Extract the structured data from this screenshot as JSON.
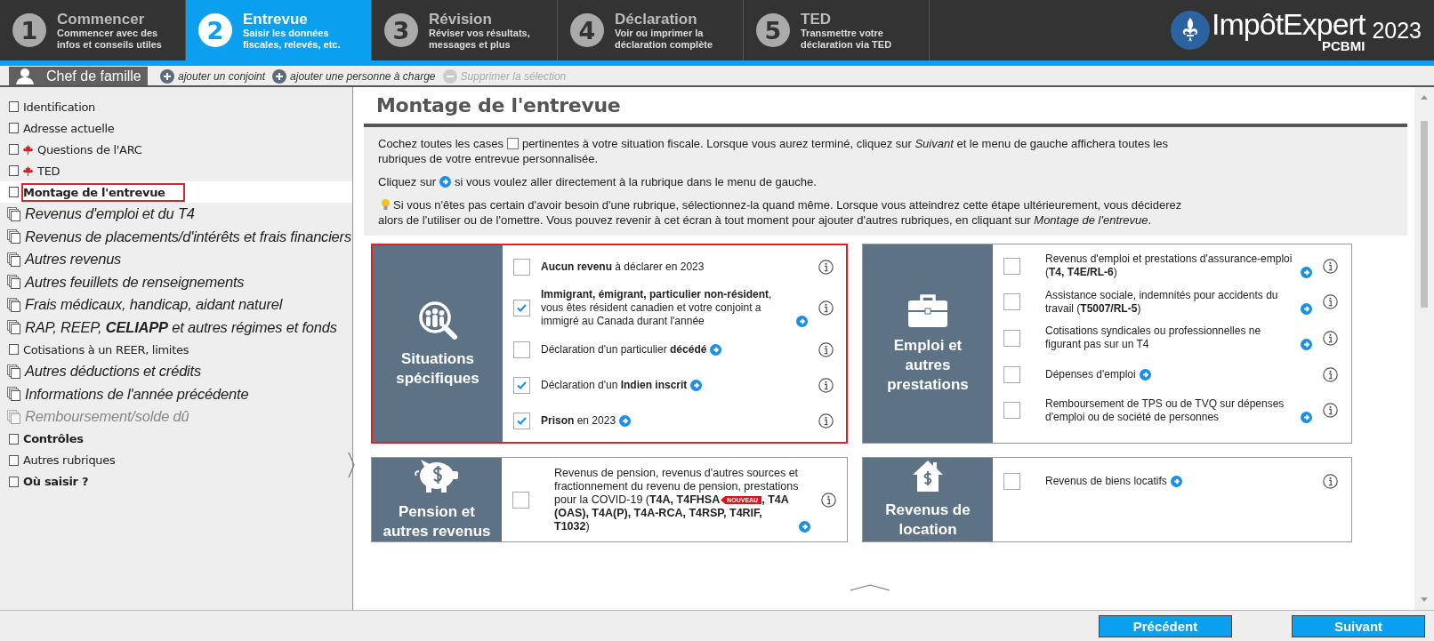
{
  "steps": [
    {
      "number": "1",
      "title": "Commencer",
      "subtitle": "Commencer avec des infos et conseils utiles",
      "selected": false
    },
    {
      "number": "2",
      "title": "Entrevue",
      "subtitle": "Saisir les données fiscales, relevés, etc.",
      "selected": true
    },
    {
      "number": "3",
      "title": "Révision",
      "subtitle": "Réviser vos résultats, messages et plus",
      "selected": false
    },
    {
      "number": "4",
      "title": "Déclaration",
      "subtitle": "Voir ou imprimer la déclaration complète",
      "selected": false
    },
    {
      "number": "5",
      "title": "TED",
      "subtitle": "Transmettre votre déclaration via TED",
      "selected": false
    }
  ],
  "logo": {
    "name": "ImpôtExpert",
    "edition": "PCBMI",
    "year": "2023"
  },
  "person_bar": {
    "tab": "Chef de famille",
    "actions": [
      {
        "label": "ajouter un conjoint",
        "disabled": false
      },
      {
        "label": "ajouter une personne à charge",
        "disabled": false
      },
      {
        "label": "Supprimer la sélection",
        "disabled": true
      }
    ]
  },
  "sidebar": {
    "items": [
      {
        "label": "Identification",
        "kind": "page",
        "bold": false,
        "disabled": false,
        "selected": false
      },
      {
        "label": "Adresse actuelle",
        "kind": "page",
        "bold": false,
        "disabled": false,
        "selected": false
      },
      {
        "label": "Questions de l'ARC",
        "kind": "federal",
        "bold": false,
        "disabled": false,
        "selected": false
      },
      {
        "label": "TED",
        "kind": "federal",
        "bold": false,
        "disabled": false,
        "selected": false
      },
      {
        "label": "Montage de l'entrevue",
        "kind": "page",
        "bold": true,
        "disabled": false,
        "selected": true
      },
      {
        "label": "Revenus d'emploi et du T4",
        "kind": "group",
        "bold": false,
        "disabled": false,
        "selected": false
      },
      {
        "label": "Revenus de placements/d'intérêts et frais financiers",
        "kind": "group",
        "bold": false,
        "disabled": false,
        "selected": false
      },
      {
        "label": "Autres revenus",
        "kind": "group",
        "bold": false,
        "disabled": false,
        "selected": false
      },
      {
        "label": "Autres feuillets de renseignements",
        "kind": "group",
        "bold": false,
        "disabled": false,
        "selected": false
      },
      {
        "label": "Frais médicaux, handicap, aidant naturel",
        "kind": "group",
        "bold": false,
        "disabled": false,
        "selected": false
      },
      {
        "label": "RAP, REEP, **CELIAPP** et autres régimes et fonds",
        "kind": "group",
        "bold": false,
        "disabled": false,
        "selected": false
      },
      {
        "label": "Cotisations à un REER, limites",
        "kind": "page",
        "bold": false,
        "disabled": false,
        "selected": false
      },
      {
        "label": "Autres déductions et crédits",
        "kind": "group",
        "bold": false,
        "disabled": false,
        "selected": false
      },
      {
        "label": "Informations de l'année précédente",
        "kind": "group",
        "bold": false,
        "disabled": false,
        "selected": false
      },
      {
        "label": "Remboursement/solde dû",
        "kind": "group",
        "bold": false,
        "disabled": true,
        "selected": false
      },
      {
        "label": "Contrôles",
        "kind": "page",
        "bold": true,
        "disabled": false,
        "selected": false
      },
      {
        "label": "Autres rubriques",
        "kind": "page",
        "bold": false,
        "disabled": false,
        "selected": false
      },
      {
        "label": "Où saisir ?",
        "kind": "page",
        "bold": true,
        "disabled": false,
        "selected": false
      }
    ]
  },
  "main": {
    "title": "Montage de l'entrevue",
    "intro": [
      {
        "kind": "checkbox",
        "before": "Cochez toutes les cases",
        "after": "pertinentes à votre situation fiscale. Lorsque vous aurez terminé, cliquez sur *Suivant* et le menu de gauche affichera toutes les",
        "continuation": "rubriques de votre entrevue personnalisée."
      },
      {
        "kind": "arrow",
        "before": "Cliquez sur",
        "after": "si vous voulez aller directement à la rubrique dans le menu de gauche."
      },
      {
        "kind": "bulb",
        "after": "Si vous n'êtes pas certain d'avoir besoin d'une rubrique, sélectionnez-la quand même. Lorsque vous atteindrez cette étape ultérieurement, vous déciderez",
        "continuation": "alors de l'utiliser ou de l'omettre. Vous pouvez revenir à cet écran à tout moment pour ajouter d'autres rubriques, en cliquant sur *Montage de l'entrevue*."
      }
    ],
    "cards": [
      {
        "title": "Situations spécifiques",
        "selected": true,
        "items": [
          {
            "lines": [
              {
                "text": "**Aucun revenu** à déclarer en 2023"
              }
            ],
            "link": false,
            "checked": false
          },
          {
            "lines": [
              {
                "text": "**Immigrant, émigrant, particulier non-résident**, vous êtes résident canadien et votre conjoint a immigré au Canada durant l'année"
              }
            ],
            "link": true,
            "checked": true
          },
          {
            "lines": [
              {
                "text": "Déclaration d'un particulier **décédé**"
              }
            ],
            "link": true,
            "checked": false
          },
          {
            "lines": [
              {
                "text": "Déclaration d'un **Indien inscrit**"
              }
            ],
            "link": true,
            "checked": true
          },
          {
            "lines": [
              {
                "text": "**Prison** en 2023"
              }
            ],
            "link": true,
            "checked": true
          }
        ]
      },
      {
        "title": "Emploi et autres prestations",
        "selected": false,
        "items": [
          {
            "lines": [
              {
                "text": "Revenus d'emploi et prestations d'assurance-emploi (**T4, T4E/RL-6**)"
              }
            ],
            "link": true,
            "checked": false
          },
          {
            "lines": [
              {
                "text": "Assistance sociale, indemnités pour accidents du travail (**T5007/RL-5**)"
              }
            ],
            "link": true,
            "checked": false
          },
          {
            "lines": [
              {
                "text": "Cotisations syndicales ou professionnelles ne figurant pas sur un T4"
              }
            ],
            "link": true,
            "checked": false
          },
          {
            "lines": [
              {
                "text": "Dépenses d'emploi"
              }
            ],
            "link": true,
            "checked": false
          },
          {
            "lines": [
              {
                "text": "Remboursement de TPS ou de TVQ sur dépenses d'emploi ou de société de personnes"
              }
            ],
            "link": true,
            "checked": false
          }
        ]
      },
      {
        "title": "Pension et autres revenus",
        "selected": false,
        "items": [
          {
            "lines": [
              {
                "text": "Revenus de pension, revenus d'autres sources et fractionnement du revenu de pension, prestations"
              },
              {
                "text": "pour la COVID-19 (**T4A, T4FHSA**",
                "badge": "NOUVEAU",
                "text_after": "**, T4A**"
              },
              {
                "text": "**(OAS), T4A(P), T4A-RCA, T4RSP, T4RIF, T1032**)"
              }
            ],
            "link": true,
            "checked": false
          }
        ]
      },
      {
        "title": "Revenus de location",
        "selected": false,
        "items": [
          {
            "lines": [
              {
                "text": "Revenus de biens locatifs"
              }
            ],
            "link": true,
            "checked": false
          }
        ]
      }
    ]
  },
  "footer": {
    "buttons": [
      "Précédent",
      "Suivant"
    ]
  }
}
